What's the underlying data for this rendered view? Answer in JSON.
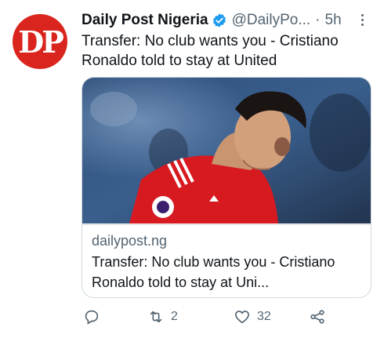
{
  "tweet": {
    "avatar_text": "DP",
    "name": "Daily Post Nigeria",
    "handle": "@DailyPo...",
    "separator": "·",
    "time": "5h",
    "text": "Transfer: No club wants you - Cristiano Ronaldo told to stay at United"
  },
  "card": {
    "domain": "dailypost.ng",
    "title": "Transfer: No club wants you - Cristiano Ronaldo told to stay at Uni..."
  },
  "actions": {
    "reply_count": "",
    "retweet_count": "2",
    "like_count": "32"
  },
  "colors": {
    "brand_red": "#d9251d",
    "verified_blue": "#1d9bf0",
    "muted_text": "#536471"
  },
  "icons": [
    "verified-icon",
    "more-icon",
    "reply-icon",
    "retweet-icon",
    "like-icon",
    "share-icon"
  ]
}
